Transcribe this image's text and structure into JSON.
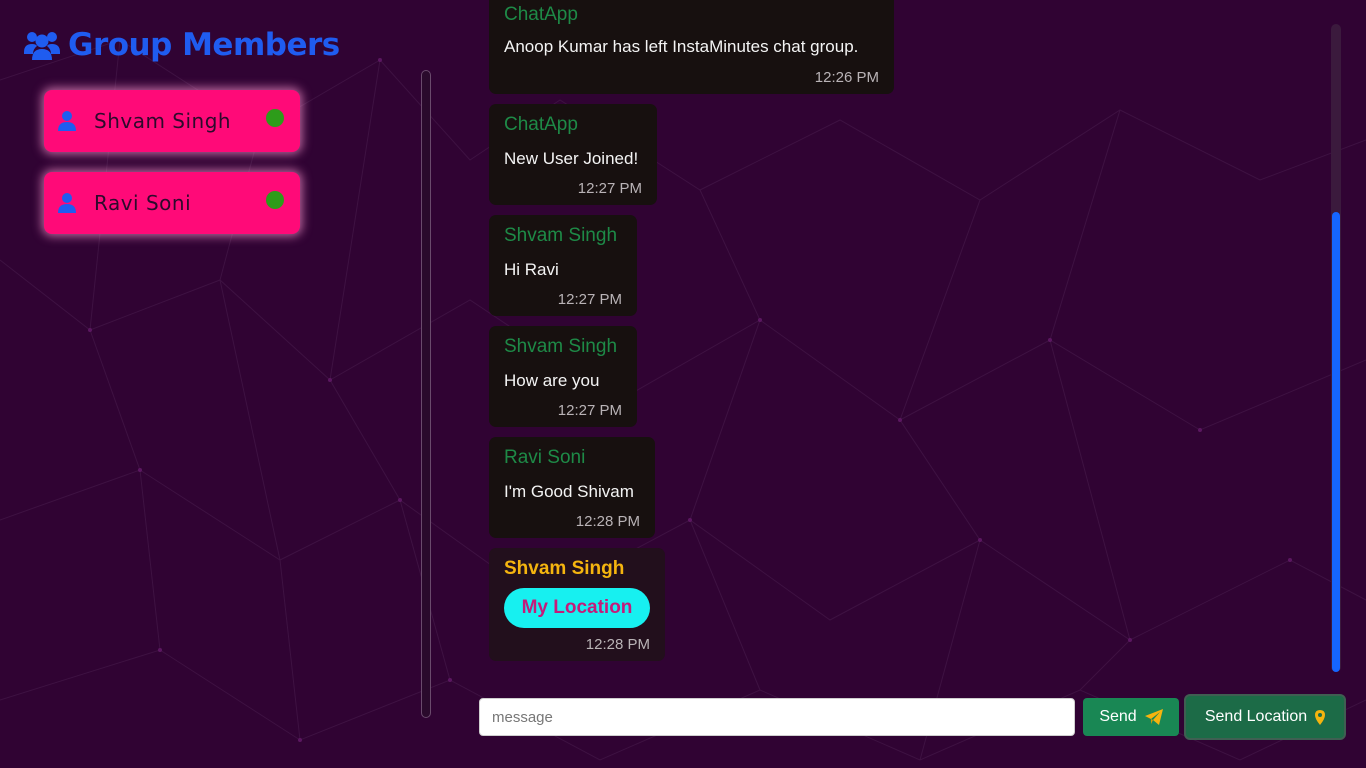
{
  "sidebar": {
    "title": "Group Members",
    "members": [
      {
        "name": "Shvam Singh",
        "status": "online"
      },
      {
        "name": "Ravi Soni",
        "status": "online"
      }
    ]
  },
  "chat": {
    "messages": [
      {
        "sender": "ChatApp",
        "text": "Anoop Kumar has left InstaMinutes chat group.",
        "time": "12:26 PM"
      },
      {
        "sender": "ChatApp",
        "text": "New User Joined!",
        "time": "12:27 PM"
      },
      {
        "sender": "Shvam Singh",
        "text": "Hi Ravi",
        "time": "12:27 PM"
      },
      {
        "sender": "Shvam Singh",
        "text": "How are you",
        "time": "12:27 PM"
      },
      {
        "sender": "Ravi Soni",
        "text": "I'm Good Shivam",
        "time": "12:28 PM"
      },
      {
        "sender": "Shvam Singh",
        "link": "My Location",
        "time": "12:28 PM"
      }
    ]
  },
  "composer": {
    "placeholder": "message",
    "send_label": "Send",
    "send_location_label": "Send Location"
  },
  "colors": {
    "background": "#300333",
    "member_card": "#ff0a78",
    "title": "#1f5cf0",
    "sender_name": "#1e8a47",
    "own_sender_name": "#f5b40f",
    "location_pill": "#17f0f0",
    "send_button": "#198754",
    "scroll_thumb": "#1565ff"
  },
  "icons": {
    "title": "users-icon",
    "member": "user-icon",
    "send": "paper-plane-icon",
    "location": "map-marker-icon"
  }
}
